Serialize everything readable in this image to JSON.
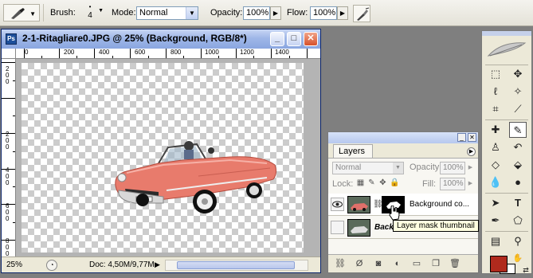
{
  "options_bar": {
    "brush_label": "Brush:",
    "brush_size": "4",
    "mode_label": "Mode:",
    "mode_value": "Normal",
    "opacity_label": "Opacity:",
    "opacity_value": "100%",
    "flow_label": "Flow:",
    "flow_value": "100%"
  },
  "document": {
    "title": "2-1-Ritagliare0.JPG @ 25% (Background, RGB/8*)",
    "ps_icon": "Ps",
    "ruler_h": [
      "0",
      "200",
      "400",
      "600",
      "800",
      "1000",
      "1200",
      "1400"
    ],
    "ruler_v": [
      "2",
      "0",
      "0",
      "2",
      "0",
      "0",
      "4",
      "0",
      "0",
      "6",
      "0",
      "0",
      "8",
      "0",
      "0"
    ],
    "status_zoom": "25%",
    "status_doc": "Doc: 4,50M/9,77M"
  },
  "layers_panel": {
    "tab_label": "Layers",
    "blend_mode": "Normal",
    "opacity_label": "Opacity:",
    "opacity_value": "100%",
    "lock_label": "Lock:",
    "fill_label": "Fill:",
    "fill_value": "100%",
    "layers": [
      {
        "name": "Background co...",
        "selected": true
      },
      {
        "name": "Backg",
        "selected": false
      }
    ],
    "tooltip": "Layer mask thumbnail"
  },
  "toolbox": {
    "tools": [
      "marquee-tool-icon",
      "move-tool-icon",
      "lasso-tool-icon",
      "magic-wand-icon",
      "crop-tool-icon",
      "slice-tool-icon",
      "healing-brush-icon",
      "brush-tool-icon",
      "clone-stamp-icon",
      "history-brush-icon",
      "eraser-tool-icon",
      "paint-bucket-icon",
      "blur-tool-icon",
      "dodge-tool-icon",
      "path-selection-icon",
      "type-tool-icon",
      "pen-tool-icon",
      "shape-tool-icon",
      "notes-tool-icon",
      "eyedropper-icon",
      "hand-tool-icon",
      "zoom-tool-icon"
    ],
    "foreground_color": "#b02a1d",
    "background_color": "#ffffff"
  },
  "colors": {
    "titlebar": "#9fb7e8",
    "car_body": "#e87b6c",
    "workspace": "#7f7f7f"
  }
}
